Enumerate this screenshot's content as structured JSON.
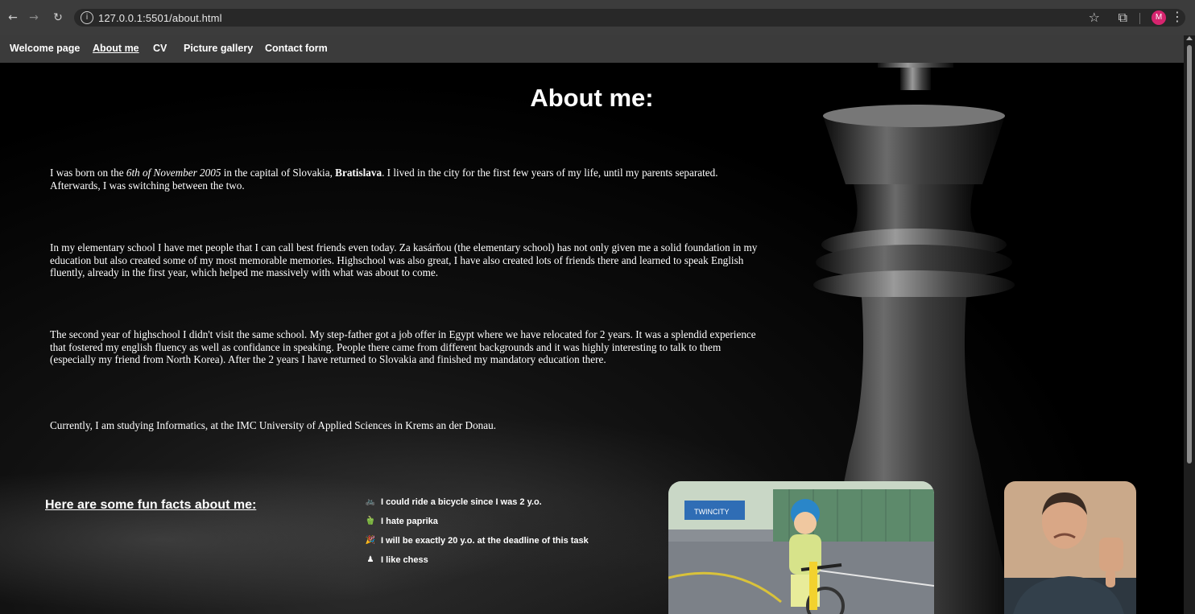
{
  "browser": {
    "url": "127.0.0.1:5501/about.html",
    "profile_initial": "M",
    "profile_color": "#d6246e"
  },
  "nav": {
    "items": [
      {
        "label": "Welcome page",
        "active": false
      },
      {
        "label": "About me",
        "active": true
      },
      {
        "label": "CV",
        "active": false
      },
      {
        "label": "Picture gallery",
        "active": false
      },
      {
        "label": "Contact form",
        "active": false
      }
    ]
  },
  "page": {
    "title": "About me:",
    "p1": {
      "a": "I was born on the ",
      "date": "6th of November 2005",
      "b": " in the capital of Slovakia, ",
      "city": "Bratislava",
      "c": ". I lived in the city for the first few years of my life, until my parents separated. Afterwards, I was switching between the two."
    },
    "p2": "In my elementary school I have met people that I can call best friends even today. Za kasárňou (the elementary school) has not only given me a solid foundation in my education but also created some of my most memorable memories. Highschool was also great, I have also created lots of friends there and learned to speak English fluently, already in the first year, which helped me massively with what was about to come.",
    "p3": "The second year of highschool I didn't visit the same school. My step-father got a job offer in Egypt where we have relocated for 2 years. It was a splendid experience that fostered my english fluency as well as confidance in speaking. People there came from different backgrounds and it was highly interesting to talk to them (especially my friend from North Korea). After the 2 years I have returned to Slovakia and finished my mandatory education there.",
    "p4": "Currently, I am studying Informatics, at the IMC University of Applied Sciences in Krems an der Donau.",
    "facts_heading": "Here are some fun facts about me:",
    "facts": [
      {
        "icon": "bicycle-icon",
        "glyph": "🚲",
        "text": "I could ride a bicycle since I was 2 y.o."
      },
      {
        "icon": "pepper-icon",
        "glyph": "🫑",
        "text": "I hate paprika"
      },
      {
        "icon": "party-icon",
        "glyph": "🎉",
        "text": "I will be exactly 20 y.o. at the deadline of this task"
      },
      {
        "icon": "chess-pawn-icon",
        "glyph": "♟",
        "text": "I like chess"
      }
    ],
    "bike_sign": "TWINCITY"
  }
}
